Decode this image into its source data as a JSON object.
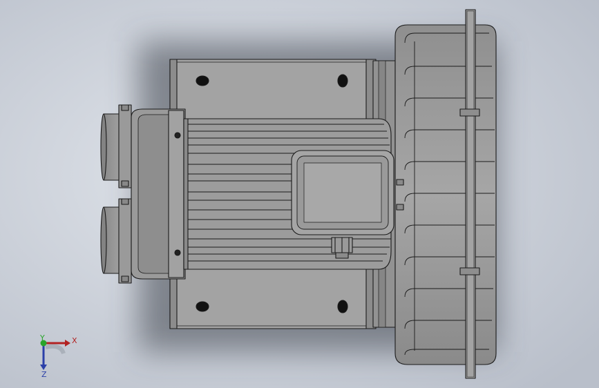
{
  "viewport": {
    "background": "#b9bfca",
    "background_light": "#e2e6ec",
    "model_fill": "#9b9b9b",
    "model_dark": "#7a7a7a",
    "edge_color": "#1a1a1a"
  },
  "model": {
    "components": [
      "motor-housing",
      "mounting-base",
      "inlet-port",
      "outlet-port",
      "terminal-box",
      "cable-gland",
      "impeller-casing"
    ]
  },
  "triad": {
    "x_label": "X",
    "y_label": "Y",
    "z_label": "Z",
    "x_color": "#b22222",
    "y_color": "#2aa52a",
    "z_color": "#2b3fa8"
  }
}
